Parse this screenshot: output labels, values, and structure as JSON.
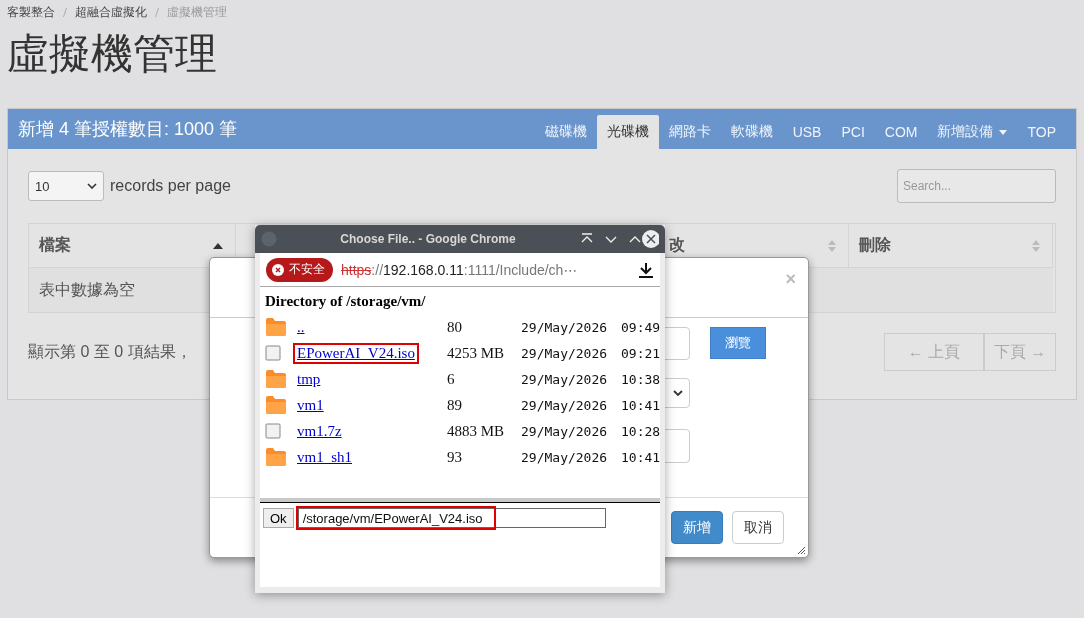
{
  "breadcrumb": [
    {
      "label": "客製整合",
      "current": false
    },
    {
      "label": "超融合虛擬化",
      "current": false
    },
    {
      "label": "虛擬機管理",
      "current": true
    }
  ],
  "page_title": "虛擬機管理",
  "panel": {
    "title": "新增 4 筆授權數目: 1000 筆",
    "tabs": [
      {
        "label": "磁碟機",
        "selected": false,
        "dropdown": false
      },
      {
        "label": "光碟機",
        "selected": true,
        "dropdown": false
      },
      {
        "label": "網路卡",
        "selected": false,
        "dropdown": false
      },
      {
        "label": "軟碟機",
        "selected": false,
        "dropdown": false
      },
      {
        "label": "USB",
        "selected": false,
        "dropdown": false
      },
      {
        "label": "PCI",
        "selected": false,
        "dropdown": false
      },
      {
        "label": "COM",
        "selected": false,
        "dropdown": false
      },
      {
        "label": "新增設備",
        "selected": false,
        "dropdown": true
      },
      {
        "label": "TOP",
        "selected": false,
        "dropdown": false
      }
    ]
  },
  "page_size": {
    "value": "10",
    "label": "records per page"
  },
  "search": {
    "placeholder": "Search..."
  },
  "table": {
    "columns": [
      {
        "label": "檔案",
        "sorted": true
      },
      {
        "label": "改",
        "sorted": false
      },
      {
        "label": "刪除",
        "sorted": false
      }
    ],
    "empty_message": "表中數據為空"
  },
  "info": "顯示第 0 至 0 項結果，",
  "pagination": {
    "previous": "← 上頁",
    "next": "下頁 →",
    "disabled": true
  },
  "modal": {
    "close": "×",
    "browse_button": "瀏覽",
    "buttons": [
      {
        "label": "新增",
        "kind": "primary"
      },
      {
        "label": "取消",
        "kind": "default"
      }
    ]
  },
  "popup": {
    "title": "Choose File.. - Google Chrome",
    "security": "不安全",
    "url": [
      {
        "kind": "insecure-scheme",
        "text": "https"
      },
      {
        "kind": "path",
        "text": "://"
      },
      {
        "kind": "host",
        "text": "192.168.0.11"
      },
      {
        "kind": "path",
        "text": ":1111/Include/ch⋯"
      }
    ],
    "heading": "Directory of /storage/vm/",
    "entries": [
      {
        "kind": "folder",
        "name": "..",
        "size": "80",
        "date": "29/May/2026",
        "time": "09:49",
        "highlighted": false
      },
      {
        "kind": "file",
        "name": "EPowerAI_V24.iso",
        "size": "4253 MB",
        "date": "29/May/2026",
        "time": "09:21",
        "highlighted": true
      },
      {
        "kind": "folder",
        "name": "tmp",
        "size": "6",
        "date": "29/May/2026",
        "time": "10:38",
        "highlighted": false
      },
      {
        "kind": "folder",
        "name": "vm1",
        "size": "89",
        "date": "29/May/2026",
        "time": "10:41",
        "highlighted": false
      },
      {
        "kind": "file",
        "name": "vm1.7z",
        "size": "4883 MB",
        "date": "29/May/2026",
        "time": "10:28",
        "highlighted": false
      },
      {
        "kind": "folder",
        "name": "vm1_sh1",
        "size": "93",
        "date": "29/May/2026",
        "time": "10:41",
        "highlighted": false
      }
    ],
    "ok_button": "Ok",
    "path": {
      "value": "/storage/vm/EPowerAI_V24.iso",
      "highlighted": true
    }
  }
}
